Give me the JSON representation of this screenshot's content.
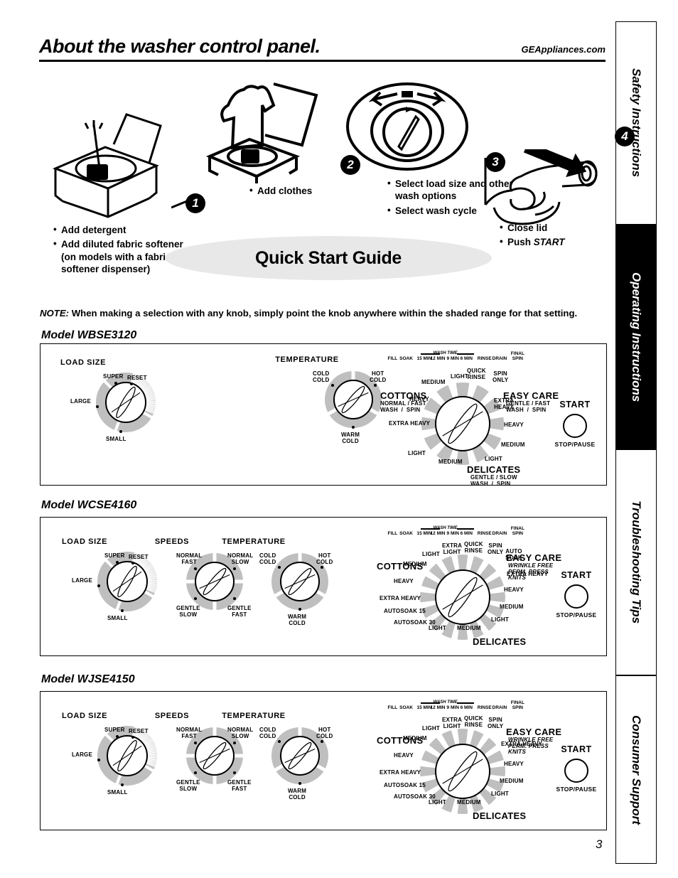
{
  "header": {
    "title": "About the washer control panel.",
    "url": "GEAppliances.com"
  },
  "sidebar": {
    "tabs": [
      {
        "label": "Safety Instructions",
        "active": false
      },
      {
        "label": "Operating Instructions",
        "active": true
      },
      {
        "label": "Troubleshooting Tips",
        "active": false
      },
      {
        "label": "Consumer Support",
        "active": false
      }
    ]
  },
  "page_number": "3",
  "quick_start": {
    "oval_title": "Quick Start Guide",
    "steps": [
      {
        "number": "1",
        "bullets": [
          "Add detergent",
          "Add diluted fabric softener (on models with a fabric softener dispenser)"
        ]
      },
      {
        "number": "2",
        "bullets": [
          "Add clothes"
        ]
      },
      {
        "number": "3",
        "bullets": [
          "Select load size and other wash options",
          "Select wash cycle"
        ]
      },
      {
        "number": "4",
        "bullets": [
          "Close lid",
          "Push START"
        ]
      }
    ]
  },
  "note": {
    "label": "NOTE:",
    "text": "When making a selection with any knob, simply point the knob anywhere within the shaded range for that setting."
  },
  "wash_time_strip": {
    "wash_time_label": "WASH TIME",
    "ticks": [
      "FILL",
      "SOAK",
      "15 MIN",
      "12 MIN",
      "9 MIN",
      "6 MIN",
      "RINSE",
      "DRAIN",
      "FINAL SPIN"
    ]
  },
  "start_button": {
    "top_label": "START",
    "bottom_label": "STOP/PAUSE"
  },
  "load_size_dial": {
    "title": "LOAD SIZE",
    "labels": [
      "SUPER",
      "RESET",
      "LARGE",
      "SMALL"
    ]
  },
  "speeds_dial": {
    "title": "SPEEDS",
    "labels": [
      "NORMAL FAST",
      "NORMAL SLOW",
      "GENTLE SLOW",
      "GENTLE FAST"
    ]
  },
  "temperature_dial": {
    "title": "TEMPERATURE",
    "labels": [
      "COLD COLD",
      "HOT COLD",
      "WARM COLD"
    ]
  },
  "models": [
    {
      "name": "Model WBSE3120",
      "dials": [
        "LOAD SIZE",
        "TEMPERATURE"
      ],
      "cycle_dial": {
        "groups": [
          {
            "name": "COTTONS",
            "sub": "NORMAL / FAST WASH  /  SPIN"
          },
          {
            "name": "EASY CARE",
            "sub": "GENTLE / FAST WASH  /  SPIN"
          },
          {
            "name": "DELICATES",
            "sub": "GENTLE / SLOW WASH  /  SPIN"
          }
        ],
        "positions": [
          "MEDIUM",
          "LIGHT",
          "QUICK RINSE",
          "SPIN ONLY",
          "EXTRA HEAVY",
          "HEAVY",
          "MEDIUM",
          "LIGHT",
          "MEDIUM",
          "LIGHT",
          "EXTRA HEAVY",
          "HEAVY"
        ]
      }
    },
    {
      "name": "Model WCSE4160",
      "dials": [
        "LOAD SIZE",
        "SPEEDS",
        "TEMPERATURE"
      ],
      "cycle_dial": {
        "groups": [
          {
            "name": "COTTONS",
            "sub": ""
          },
          {
            "name": "EASY CARE",
            "sub": "WRINKLE FREE PERM. PRESS KNITS"
          },
          {
            "name": "DELICATES",
            "sub": ""
          }
        ],
        "positions": [
          "LIGHT",
          "EXTRA LIGHT",
          "QUICK RINSE",
          "SPIN ONLY",
          "AUTO SOAK",
          "EXTRA HEAVY",
          "HEAVY",
          "MEDIUM",
          "LIGHT",
          "MEDIUM",
          "LIGHT",
          "AUTOSOAK 30",
          "AUTOSOAK 15",
          "EXTRA HEAVY",
          "HEAVY",
          "MEDIUM"
        ]
      }
    },
    {
      "name": "Model WJSE4150",
      "dials": [
        "LOAD SIZE",
        "SPEEDS",
        "TEMPERATURE"
      ],
      "cycle_dial": {
        "groups": [
          {
            "name": "COTTONS",
            "sub": ""
          },
          {
            "name": "EASY CARE",
            "sub": "WRINKLE FREE PERM. PRESS KNITS"
          },
          {
            "name": "DELICATES",
            "sub": ""
          }
        ],
        "positions": [
          "LIGHT",
          "EXTRA LIGHT",
          "QUICK RINSE",
          "SPIN ONLY",
          "EXTRA HEAVY",
          "HEAVY",
          "MEDIUM",
          "LIGHT",
          "MEDIUM",
          "LIGHT",
          "AUTOSOAK 30",
          "AUTOSOAK 15",
          "EXTRA HEAVY",
          "HEAVY",
          "MEDIUM"
        ]
      }
    }
  ],
  "easy_care_labels": {
    "wrinkle_free": "WRINKLE FREE",
    "perm_press": "PERM. PRESS",
    "knits": "KNITS"
  }
}
